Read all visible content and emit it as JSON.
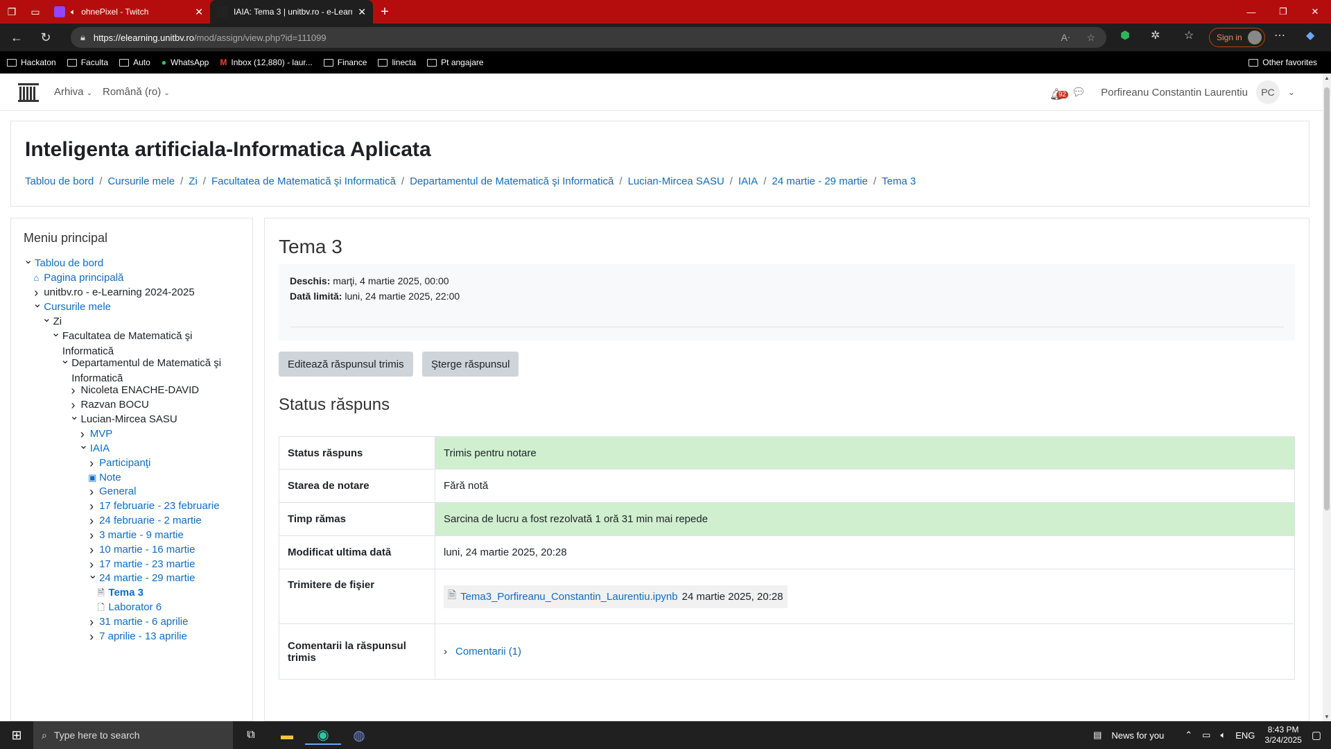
{
  "browser": {
    "tabs": [
      {
        "title": "ohnePixel - Twitch",
        "active": false,
        "fav_color": "#9146ff"
      },
      {
        "title": "IAIA: Tema 3 | unitbv.ro - e-Learni",
        "active": true,
        "fav_color": "#222222"
      }
    ],
    "url_domain": "https://elearning.unitbv.ro",
    "url_path": "/mod/assign/view.php?id=111099",
    "sign_in": "Sign in",
    "bookmarks": [
      "Hackaton",
      "Faculta",
      "Auto",
      "WhatsApp",
      "Inbox (12,880) - laur...",
      "Finance",
      "linecta",
      "Pt angajare"
    ],
    "other_favorites": "Other favorites"
  },
  "navbar": {
    "menu1": "Arhiva",
    "menu2": "Română (ro)",
    "notif_count": "92",
    "user_name": "Porfireanu Constantin Laurentiu",
    "user_initials": "PC"
  },
  "header": {
    "course_title": "Inteligenta artificiala-Informatica Aplicata",
    "breadcrumb": [
      "Tablou de bord",
      "Cursurile mele",
      "Zi",
      "Facultatea de Matematică şi Informatică",
      "Departamentul de Matematică şi Informatică",
      "Lucian-Mircea SASU",
      "IAIA",
      "24 martie - 29 martie",
      "Tema 3"
    ]
  },
  "sidebar": {
    "title": "Meniu principal",
    "items": [
      {
        "label": "Tablou de bord",
        "caret": "down",
        "link": true
      },
      {
        "label": "Pagina principală",
        "caret": "home",
        "link": true
      },
      {
        "label": "unitbv.ro - e-Learning 2024-2025",
        "caret": "right",
        "link": false
      },
      {
        "label": "Cursurile mele",
        "caret": "down",
        "link": true
      },
      {
        "label": "Zi",
        "caret": "down",
        "link": false
      },
      {
        "label": "Facultatea de Matematică şi Informatică",
        "caret": "down",
        "link": false
      },
      {
        "label": "Departamentul de Matematică şi Informatică",
        "caret": "down",
        "link": false
      },
      {
        "label": "Nicoleta ENACHE-DAVID",
        "caret": "right",
        "link": false
      },
      {
        "label": "Razvan BOCU",
        "caret": "right",
        "link": false
      },
      {
        "label": "Lucian-Mircea SASU",
        "caret": "down",
        "link": false
      },
      {
        "label": "MVP",
        "caret": "right",
        "link": true
      },
      {
        "label": "IAIA",
        "caret": "down",
        "link": true
      },
      {
        "label": "Participanţi",
        "caret": "right",
        "link": true
      },
      {
        "label": "Note",
        "caret": "grades",
        "link": true
      },
      {
        "label": "General",
        "caret": "right",
        "link": true
      },
      {
        "label": "17 februarie - 23 februarie",
        "caret": "right",
        "link": true
      },
      {
        "label": "24 februarie - 2 martie",
        "caret": "right",
        "link": true
      },
      {
        "label": "3 martie - 9 martie",
        "caret": "right",
        "link": true
      },
      {
        "label": "10 martie - 16 martie",
        "caret": "right",
        "link": true
      },
      {
        "label": "17 martie - 23 martie",
        "caret": "right",
        "link": true
      },
      {
        "label": "24 martie - 29 martie",
        "caret": "down",
        "link": true
      },
      {
        "label": "Tema 3",
        "caret": "assign",
        "link": true
      },
      {
        "label": "Laborator 6",
        "caret": "page",
        "link": true
      },
      {
        "label": "31 martie - 6 aprilie",
        "caret": "right",
        "link": true
      },
      {
        "label": "7 aprilie - 13 aprilie",
        "caret": "right",
        "link": true
      }
    ]
  },
  "main": {
    "title": "Tema 3",
    "opened_label": "Deschis:",
    "opened_value": "marţi, 4 martie 2025, 00:00",
    "due_label": "Dată limită:",
    "due_value": "luni, 24 martie 2025, 22:00",
    "edit_button": "Editează răspunsul trimis",
    "delete_button": "Şterge răspunsul",
    "status_heading": "Status răspuns",
    "rows": [
      {
        "label": "Status răspuns",
        "value": "Trimis pentru notare",
        "green": true
      },
      {
        "label": "Starea de notare",
        "value": "Fără notă",
        "green": false
      },
      {
        "label": "Timp rămas",
        "value": "Sarcina de lucru a fost rezolvată 1 oră 31 min mai repede",
        "green": true
      },
      {
        "label": "Modificat ultima dată",
        "value": "luni, 24 martie 2025, 20:28",
        "green": false
      }
    ],
    "file_label": "Trimitere de fişier",
    "file_name": "Tema3_Porfireanu_Constantin_Laurentiu.ipynb",
    "file_date": "24 martie 2025, 20:28",
    "comments_label": "Comentarii la răspunsul trimis",
    "comments_link": "Comentarii (1)"
  },
  "taskbar": {
    "search_placeholder": "Type here to search",
    "news": "News for you",
    "lang": "ENG",
    "time": "8:43 PM",
    "date": "3/24/2025"
  }
}
